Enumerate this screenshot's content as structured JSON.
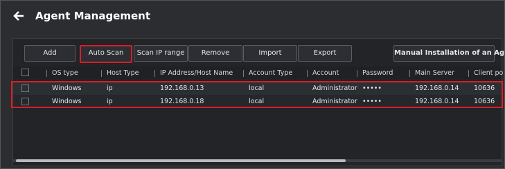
{
  "header": {
    "title": "Agent Management",
    "back_icon": "back-arrow-icon"
  },
  "toolbar": {
    "add": "Add",
    "auto_scan": "Auto Scan",
    "scan_ip_range": "Scan IP range",
    "remove": "Remove",
    "import": "Import",
    "export": "Export",
    "manual_install": "Manual Installation of an Agent"
  },
  "table": {
    "columns": [
      "OS type",
      "Host Type",
      "IP Address/Host Name",
      "Account Type",
      "Account",
      "Password",
      "Main Server",
      "Client po"
    ],
    "rows": [
      {
        "os": "Windows",
        "host_type": "ip",
        "ip": "192.168.0.13",
        "account_type": "local",
        "account": "Administrator",
        "password": "•••••",
        "main_server": "192.168.0.14",
        "client_port": "10636"
      },
      {
        "os": "Windows",
        "host_type": "ip",
        "ip": "192.168.0.18",
        "account_type": "local",
        "account": "Administrator",
        "password": "•••••",
        "main_server": "192.168.0.14",
        "client_port": "10636"
      }
    ]
  },
  "colors": {
    "highlight": "#d91f26",
    "background": "#2b2d31"
  }
}
